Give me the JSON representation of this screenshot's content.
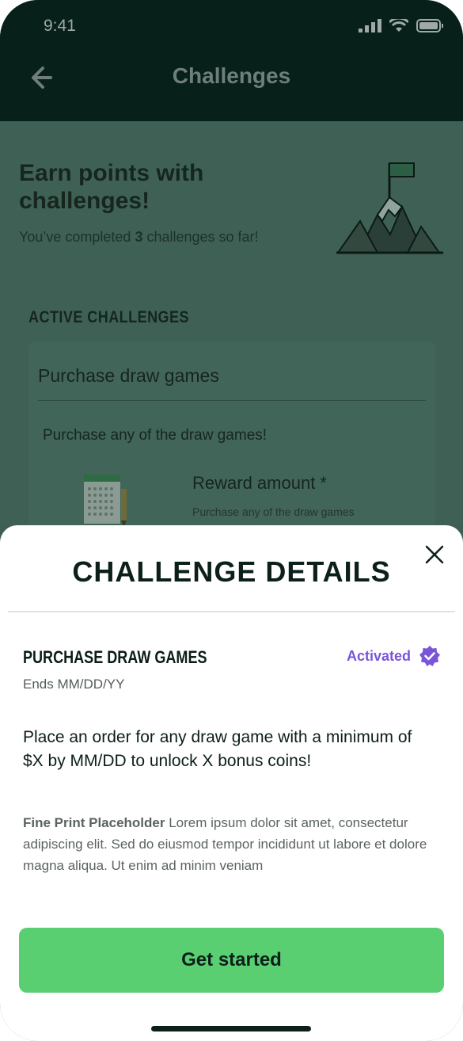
{
  "status": {
    "time": "9:41"
  },
  "header": {
    "title": "Challenges"
  },
  "intro": {
    "heading": "Earn points with challenges!",
    "completed_prefix": "You’ve completed ",
    "completed_count": "3",
    "completed_suffix": " challenges so far!"
  },
  "active": {
    "label": "ACTIVE CHALLENGES",
    "card": {
      "title": "Purchase draw games",
      "description": "Purchase any of the draw games!",
      "reward_label": "Reward amount *",
      "reward_sub": "Purchase any of the draw games"
    }
  },
  "sheet": {
    "title": "CHALLENGE DETAILS",
    "challenge_name": "PURCHASE DRAW GAMES",
    "status": "Activated",
    "ends": "Ends MM/DD/YY",
    "description": "Place an order for any draw game with a minimum of $X  by MM/DD to unlock X bonus coins!",
    "fine_print_label": "Fine Print Placeholder",
    "fine_print_text": " Lorem ipsum dolor sit amet, consectetur adipiscing elit. Sed do eiusmod tempor incididunt ut labore et dolore magna aliqua. Ut enim ad minim veniam",
    "cta": "Get started"
  },
  "colors": {
    "accent_green": "#5acf71",
    "accent_purple": "#7a55d8",
    "dark": "#07201a"
  }
}
